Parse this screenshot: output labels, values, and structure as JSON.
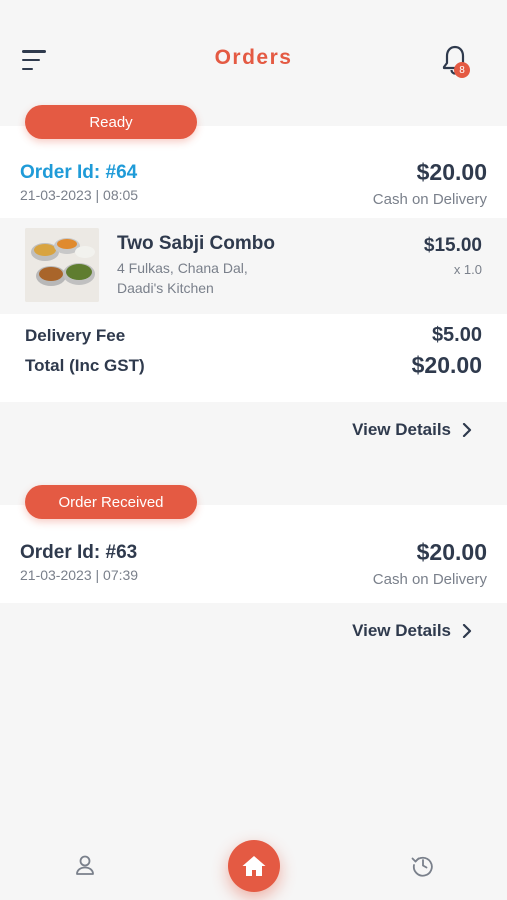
{
  "header": {
    "title": "Orders",
    "notification_count": "8"
  },
  "orders": [
    {
      "status": "Ready",
      "order_id": "Order Id: #64",
      "date": "21-03-2023 | 08:05",
      "total": "$20.00",
      "payment_method": "Cash on Delivery",
      "items": [
        {
          "name": "Two Sabji Combo",
          "description_line1": "4 Fulkas, Chana Dal,",
          "description_line2": "Daadi's Kitchen",
          "price": "$15.00",
          "quantity": "x 1.0"
        }
      ],
      "delivery_fee_label": "Delivery Fee",
      "delivery_fee": "$5.00",
      "total_label": "Total (Inc GST)",
      "total_inc_gst": "$20.00",
      "view_details_label": "View Details"
    },
    {
      "status": "Order Received",
      "order_id": "Order Id: #63",
      "date": "21-03-2023 | 07:39",
      "total": "$20.00",
      "payment_method": "Cash on Delivery",
      "view_details_label": "View Details"
    }
  ],
  "bottom_nav": {
    "items": [
      "profile-icon",
      "home-icon",
      "history-icon"
    ]
  },
  "colors": {
    "accent": "#e45a43",
    "highlight_id": "#1f9bd8",
    "text_primary": "#2f3a4d",
    "text_secondary": "#7a808b",
    "background": "#f6f6f6",
    "card": "#ffffff"
  }
}
